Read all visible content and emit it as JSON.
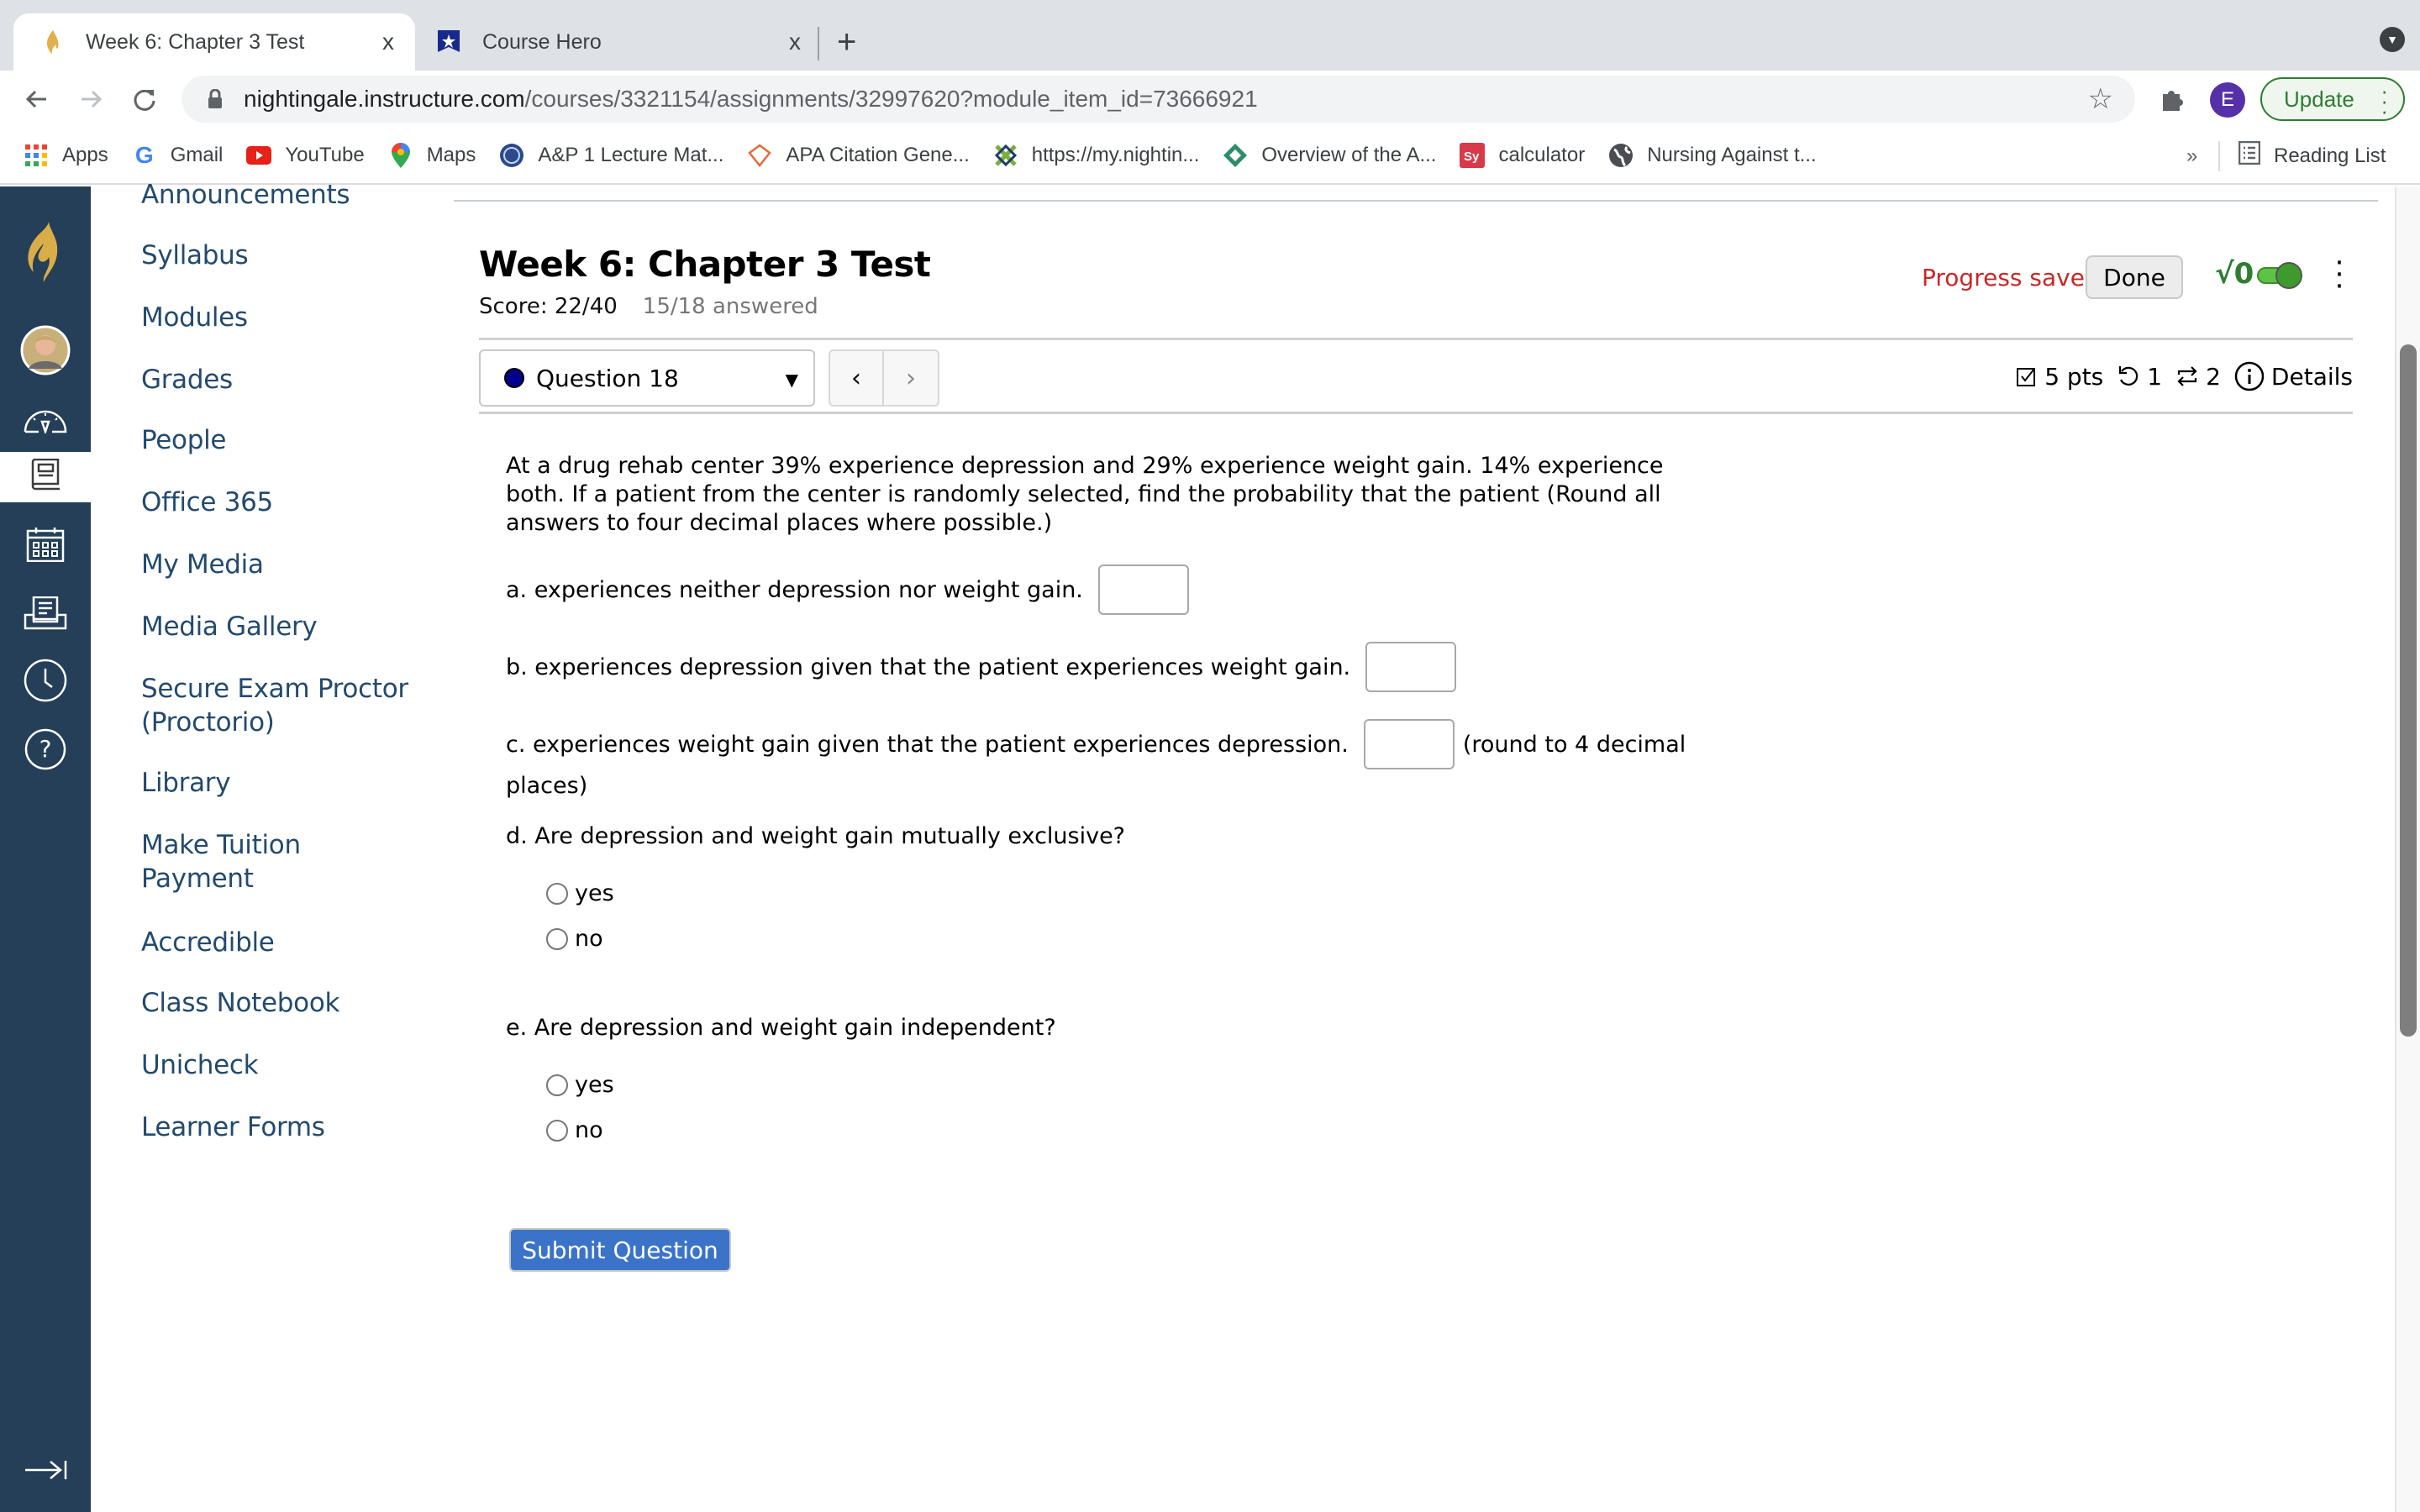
{
  "browser": {
    "tabs": [
      {
        "title": "Week 6: Chapter 3 Test",
        "favicon": "flame-icon",
        "active": true
      },
      {
        "title": "Course Hero",
        "favicon": "course-hero-icon",
        "active": false
      }
    ],
    "close_glyph": "x",
    "new_tab_glyph": "+",
    "url_host": "nightingale.instructure.com",
    "url_path": "/courses/3321154/assignments/32997620?module_item_id=73666921",
    "profile_initial": "E",
    "update_label": "Update",
    "bookmarks": [
      {
        "label": "Apps",
        "icon": "apps-grid-icon"
      },
      {
        "label": "Gmail",
        "icon": "google-icon"
      },
      {
        "label": "YouTube",
        "icon": "youtube-icon"
      },
      {
        "label": "Maps",
        "icon": "maps-pin-icon"
      },
      {
        "label": "A&P 1 Lecture Mat...",
        "icon": "college-seal-icon"
      },
      {
        "label": "APA Citation Gene...",
        "icon": "citation-icon"
      },
      {
        "label": "https://my.nightin...",
        "icon": "nightingale-knot-icon"
      },
      {
        "label": "Overview of the A...",
        "icon": "green-diamond-icon"
      },
      {
        "label": "calculator",
        "icon": "symbolab-icon"
      },
      {
        "label": "Nursing Against t...",
        "icon": "globe-icon"
      }
    ],
    "overflow_glyph": "»",
    "reading_list_label": "Reading List"
  },
  "course_nav": {
    "items": [
      "Announcements",
      "Syllabus",
      "Modules",
      "Grades",
      "People",
      "Office 365",
      "My Media",
      "Media Gallery",
      "Secure Exam Proctor (Proctorio)",
      "Library",
      "Make Tuition Payment",
      "Accredible",
      "Class Notebook",
      "Unicheck",
      "Learner Forms"
    ]
  },
  "global_nav": {
    "items": [
      "logo",
      "account",
      "dashboard",
      "courses",
      "calendar",
      "inbox",
      "history",
      "help"
    ],
    "active": "courses"
  },
  "quiz": {
    "title": "Week 6: Chapter 3 Test",
    "score": "Score: 22/40",
    "answered": "15/18 answered",
    "progress_status": "Progress saved",
    "done_label": "Done",
    "math_toggle_label": "√0",
    "math_toggle_on": true,
    "question_selector": "Question 18",
    "points": "5 pts",
    "attempts": "1",
    "versions": "2",
    "details_label": "Details",
    "accent_color": "#3b73c9",
    "status_color": "#c62828"
  },
  "question": {
    "stem": "At a drug rehab center 39% experience depression and 29% experience weight gain. 14% experience both. If a patient from the center is randomly selected, find the probability that the patient (Round all answers to four decimal places where possible.)",
    "part_a": "a. experiences neither depression nor weight gain.",
    "part_b": "b. experiences depression given that the patient experiences weight gain.",
    "part_c": "c. experiences weight gain given that the patient experiences depression.",
    "part_c_suffix": "(round to 4 decimal",
    "part_c_wrap": "places)",
    "part_d": "d. Are depression and weight gain mutually exclusive?",
    "part_e": "e. Are depression and weight gain independent?",
    "answers": {
      "a": "",
      "b": "",
      "c": ""
    },
    "option_yes": "yes",
    "option_no": "no",
    "submit_label": "Submit Question"
  }
}
